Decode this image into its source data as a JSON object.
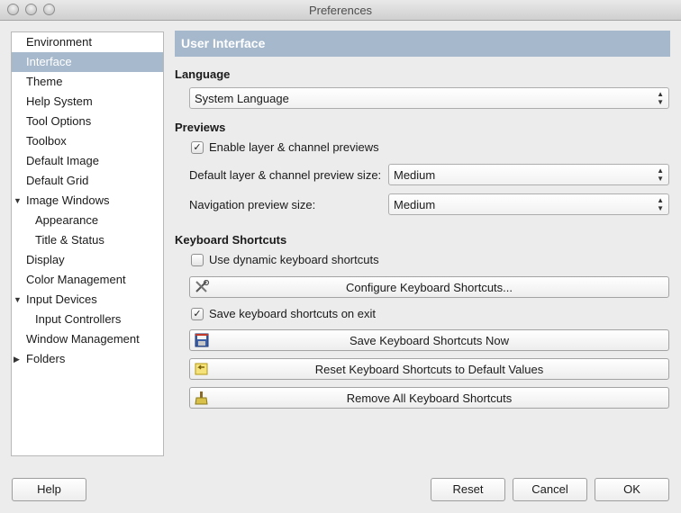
{
  "window": {
    "title": "Preferences"
  },
  "sidebar": {
    "items": [
      {
        "label": "Environment"
      },
      {
        "label": "Interface"
      },
      {
        "label": "Theme"
      },
      {
        "label": "Help System"
      },
      {
        "label": "Tool Options"
      },
      {
        "label": "Toolbox"
      },
      {
        "label": "Default Image"
      },
      {
        "label": "Default Grid"
      },
      {
        "label": "Image Windows"
      },
      {
        "label": "Appearance"
      },
      {
        "label": "Title & Status"
      },
      {
        "label": "Display"
      },
      {
        "label": "Color Management"
      },
      {
        "label": "Input Devices"
      },
      {
        "label": "Input Controllers"
      },
      {
        "label": "Window Management"
      },
      {
        "label": "Folders"
      }
    ]
  },
  "panel": {
    "title": "User Interface",
    "language": {
      "heading": "Language",
      "value": "System Language"
    },
    "previews": {
      "heading": "Previews",
      "enable_label": "Enable layer & channel previews",
      "enable_checked": true,
      "default_size_label": "Default layer & channel preview size:",
      "default_size_value": "Medium",
      "nav_size_label": "Navigation preview size:",
      "nav_size_value": "Medium"
    },
    "shortcuts": {
      "heading": "Keyboard Shortcuts",
      "dynamic_label": "Use dynamic keyboard shortcuts",
      "dynamic_checked": false,
      "configure_label": "Configure Keyboard Shortcuts...",
      "save_on_exit_label": "Save keyboard shortcuts on exit",
      "save_on_exit_checked": true,
      "save_now_label": "Save Keyboard Shortcuts Now",
      "reset_label": "Reset Keyboard Shortcuts to Default Values",
      "remove_label": "Remove All Keyboard Shortcuts"
    }
  },
  "footer": {
    "help_label": "Help",
    "reset_label": "Reset",
    "cancel_label": "Cancel",
    "ok_label": "OK"
  },
  "icons": {
    "expanded": "▼",
    "collapsed": "▶",
    "check": "✓"
  }
}
